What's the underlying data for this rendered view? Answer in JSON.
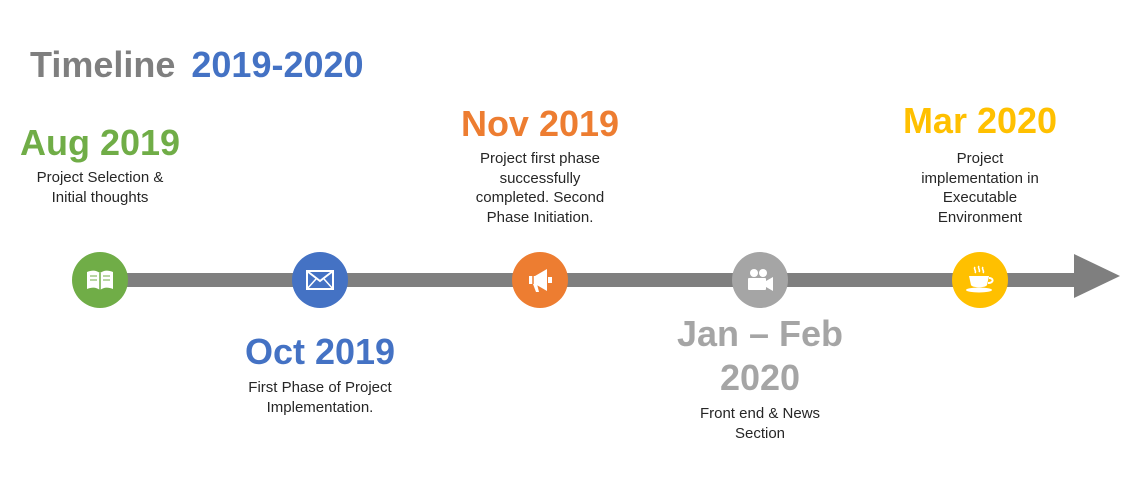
{
  "title": {
    "word": "Timeline",
    "range": "2019-2020"
  },
  "colors": {
    "axis": "#7f7f7f",
    "green": "#70ad47",
    "blue": "#4472c4",
    "orange": "#ed7d31",
    "gray": "#a5a5a5",
    "gold": "#ffc000"
  },
  "milestones": [
    {
      "date": "Aug 2019",
      "description": "Project Selection & Initial thoughts",
      "icon": "book-icon",
      "color": "#70ad47",
      "label_position": "above"
    },
    {
      "date": "Oct 2019",
      "description": "First Phase of Project Implementation.",
      "icon": "envelope-icon",
      "color": "#4472c4",
      "label_position": "below"
    },
    {
      "date": "Nov 2019",
      "description": "Project first phase successfully completed. Second Phase Initiation.",
      "icon": "megaphone-icon",
      "color": "#ed7d31",
      "label_position": "above"
    },
    {
      "date": "Jan – Feb 2020",
      "description": "Front end & News Section",
      "icon": "video-camera-icon",
      "color": "#a5a5a5",
      "label_position": "below"
    },
    {
      "date": "Mar 2020",
      "description": "Project implementation in Executable Environment",
      "icon": "coffee-cup-icon",
      "color": "#ffc000",
      "label_position": "above"
    }
  ]
}
